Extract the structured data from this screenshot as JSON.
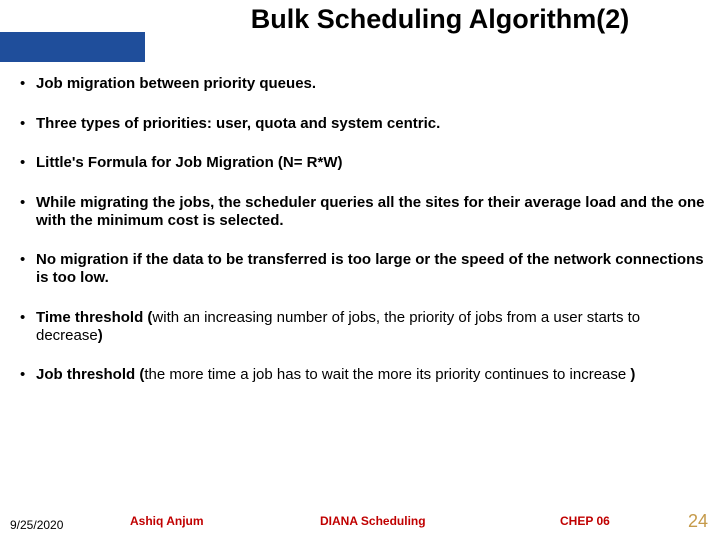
{
  "title": "Bulk Scheduling Algorithm(2)",
  "bullets": [
    {
      "bold": "Job migration between priority queues.",
      "paren": ""
    },
    {
      "bold": "Three types of priorities: user, quota and system centric.",
      "paren": ""
    },
    {
      "bold": "Little's Formula for Job Migration (N= R*W)",
      "paren": ""
    },
    {
      "bold": "While migrating the jobs, the scheduler queries all the sites for their average load and the one with the minimum cost is selected.",
      "paren": ""
    },
    {
      "bold": "No migration if the data to be transferred is too large or the speed of the network connections is too low.",
      "paren": ""
    },
    {
      "bold": "Time threshold (",
      "paren": "with an increasing number of jobs, the priority of jobs from a user starts to decrease",
      "bold_end": ")"
    },
    {
      "bold": "Job threshold (",
      "paren": "the more time a job has to wait the more its priority continues to increase ",
      "bold_end": ")"
    }
  ],
  "footer": {
    "date": "9/25/2020",
    "author": "Ashiq Anjum",
    "project": "DIANA Scheduling",
    "conference": "CHEP 06",
    "page": "24"
  }
}
